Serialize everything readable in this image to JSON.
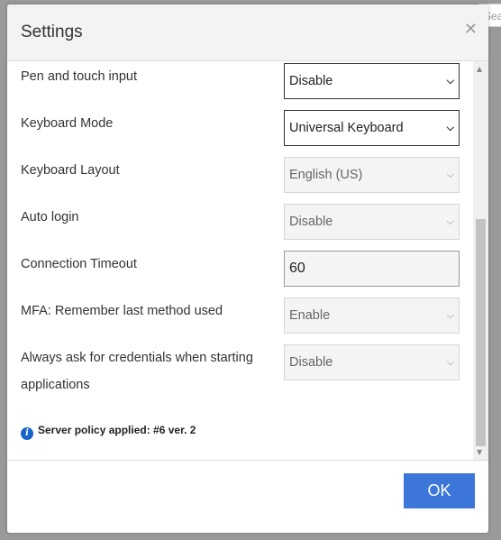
{
  "background": {
    "search_placeholder": "Sea"
  },
  "dialog": {
    "title": "Settings",
    "close_icon": "close-icon"
  },
  "settings": [
    {
      "label": "Pen and touch input",
      "value": "Disable"
    },
    {
      "label": "Keyboard Mode",
      "value": "Universal Keyboard"
    },
    {
      "label": "Keyboard Layout",
      "value": "English (US)"
    },
    {
      "label": "Auto login",
      "value": "Disable"
    },
    {
      "label": "Connection Timeout",
      "value": "60"
    },
    {
      "label": "MFA: Remember last method used",
      "value": "Enable"
    },
    {
      "label": "Always ask for credentials when starting applications",
      "value": "Disable"
    }
  ],
  "policy": {
    "text": "Server policy applied: #6 ver. 2",
    "icon": "info-icon"
  },
  "footer": {
    "ok_label": "OK"
  },
  "colors": {
    "accent": "#3b76d8",
    "info": "#1a63c9"
  }
}
